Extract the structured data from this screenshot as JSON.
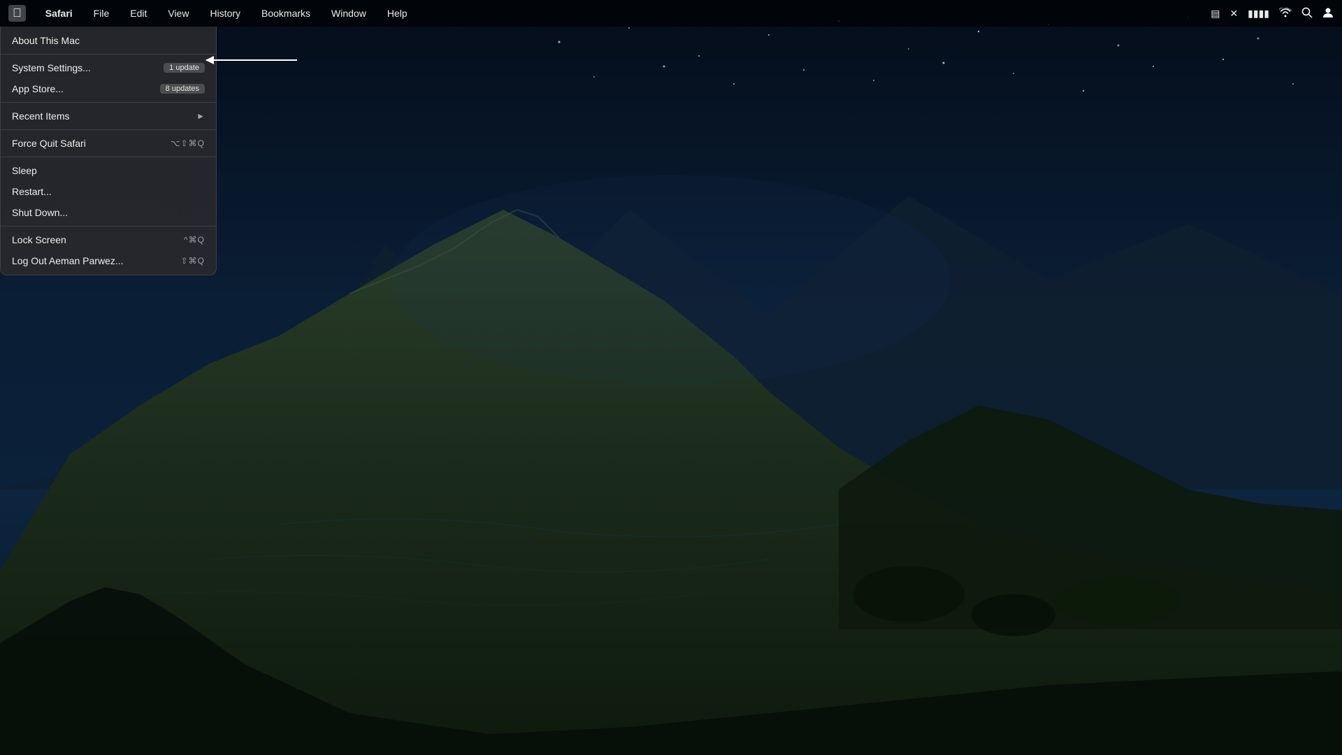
{
  "menubar": {
    "apple_label": "",
    "app_name": "Safari",
    "items": [
      "File",
      "Edit",
      "View",
      "History",
      "Bookmarks",
      "Window",
      "Help"
    ],
    "right_icons": [
      "⊞",
      "✕",
      "🔋",
      "WiFi",
      "🔍",
      "👤"
    ]
  },
  "apple_menu": {
    "items": [
      {
        "id": "about",
        "label": "About This Mac",
        "badge": null,
        "shortcut": null,
        "arrow": false,
        "separator_after": false
      },
      {
        "id": "system-settings",
        "label": "System Settings...",
        "badge": "1 update",
        "shortcut": null,
        "arrow": false,
        "separator_after": false
      },
      {
        "id": "app-store",
        "label": "App Store...",
        "badge": "8 updates",
        "shortcut": null,
        "arrow": false,
        "separator_after": true
      },
      {
        "id": "recent-items",
        "label": "Recent Items",
        "badge": null,
        "shortcut": null,
        "arrow": true,
        "separator_after": true
      },
      {
        "id": "force-quit",
        "label": "Force Quit Safari",
        "badge": null,
        "shortcut": "⌥⇧⌘Q",
        "arrow": false,
        "separator_after": true
      },
      {
        "id": "sleep",
        "label": "Sleep",
        "badge": null,
        "shortcut": null,
        "arrow": false,
        "separator_after": false
      },
      {
        "id": "restart",
        "label": "Restart...",
        "badge": null,
        "shortcut": null,
        "arrow": false,
        "separator_after": false
      },
      {
        "id": "shut-down",
        "label": "Shut Down...",
        "badge": null,
        "shortcut": null,
        "arrow": false,
        "separator_after": true
      },
      {
        "id": "lock-screen",
        "label": "Lock Screen",
        "badge": null,
        "shortcut": "^⌘Q",
        "arrow": false,
        "separator_after": false
      },
      {
        "id": "log-out",
        "label": "Log Out Aeman Parwez...",
        "badge": null,
        "shortcut": "⇧⌘Q",
        "arrow": false,
        "separator_after": false
      }
    ]
  },
  "annotation_arrow": {
    "visible": true
  }
}
